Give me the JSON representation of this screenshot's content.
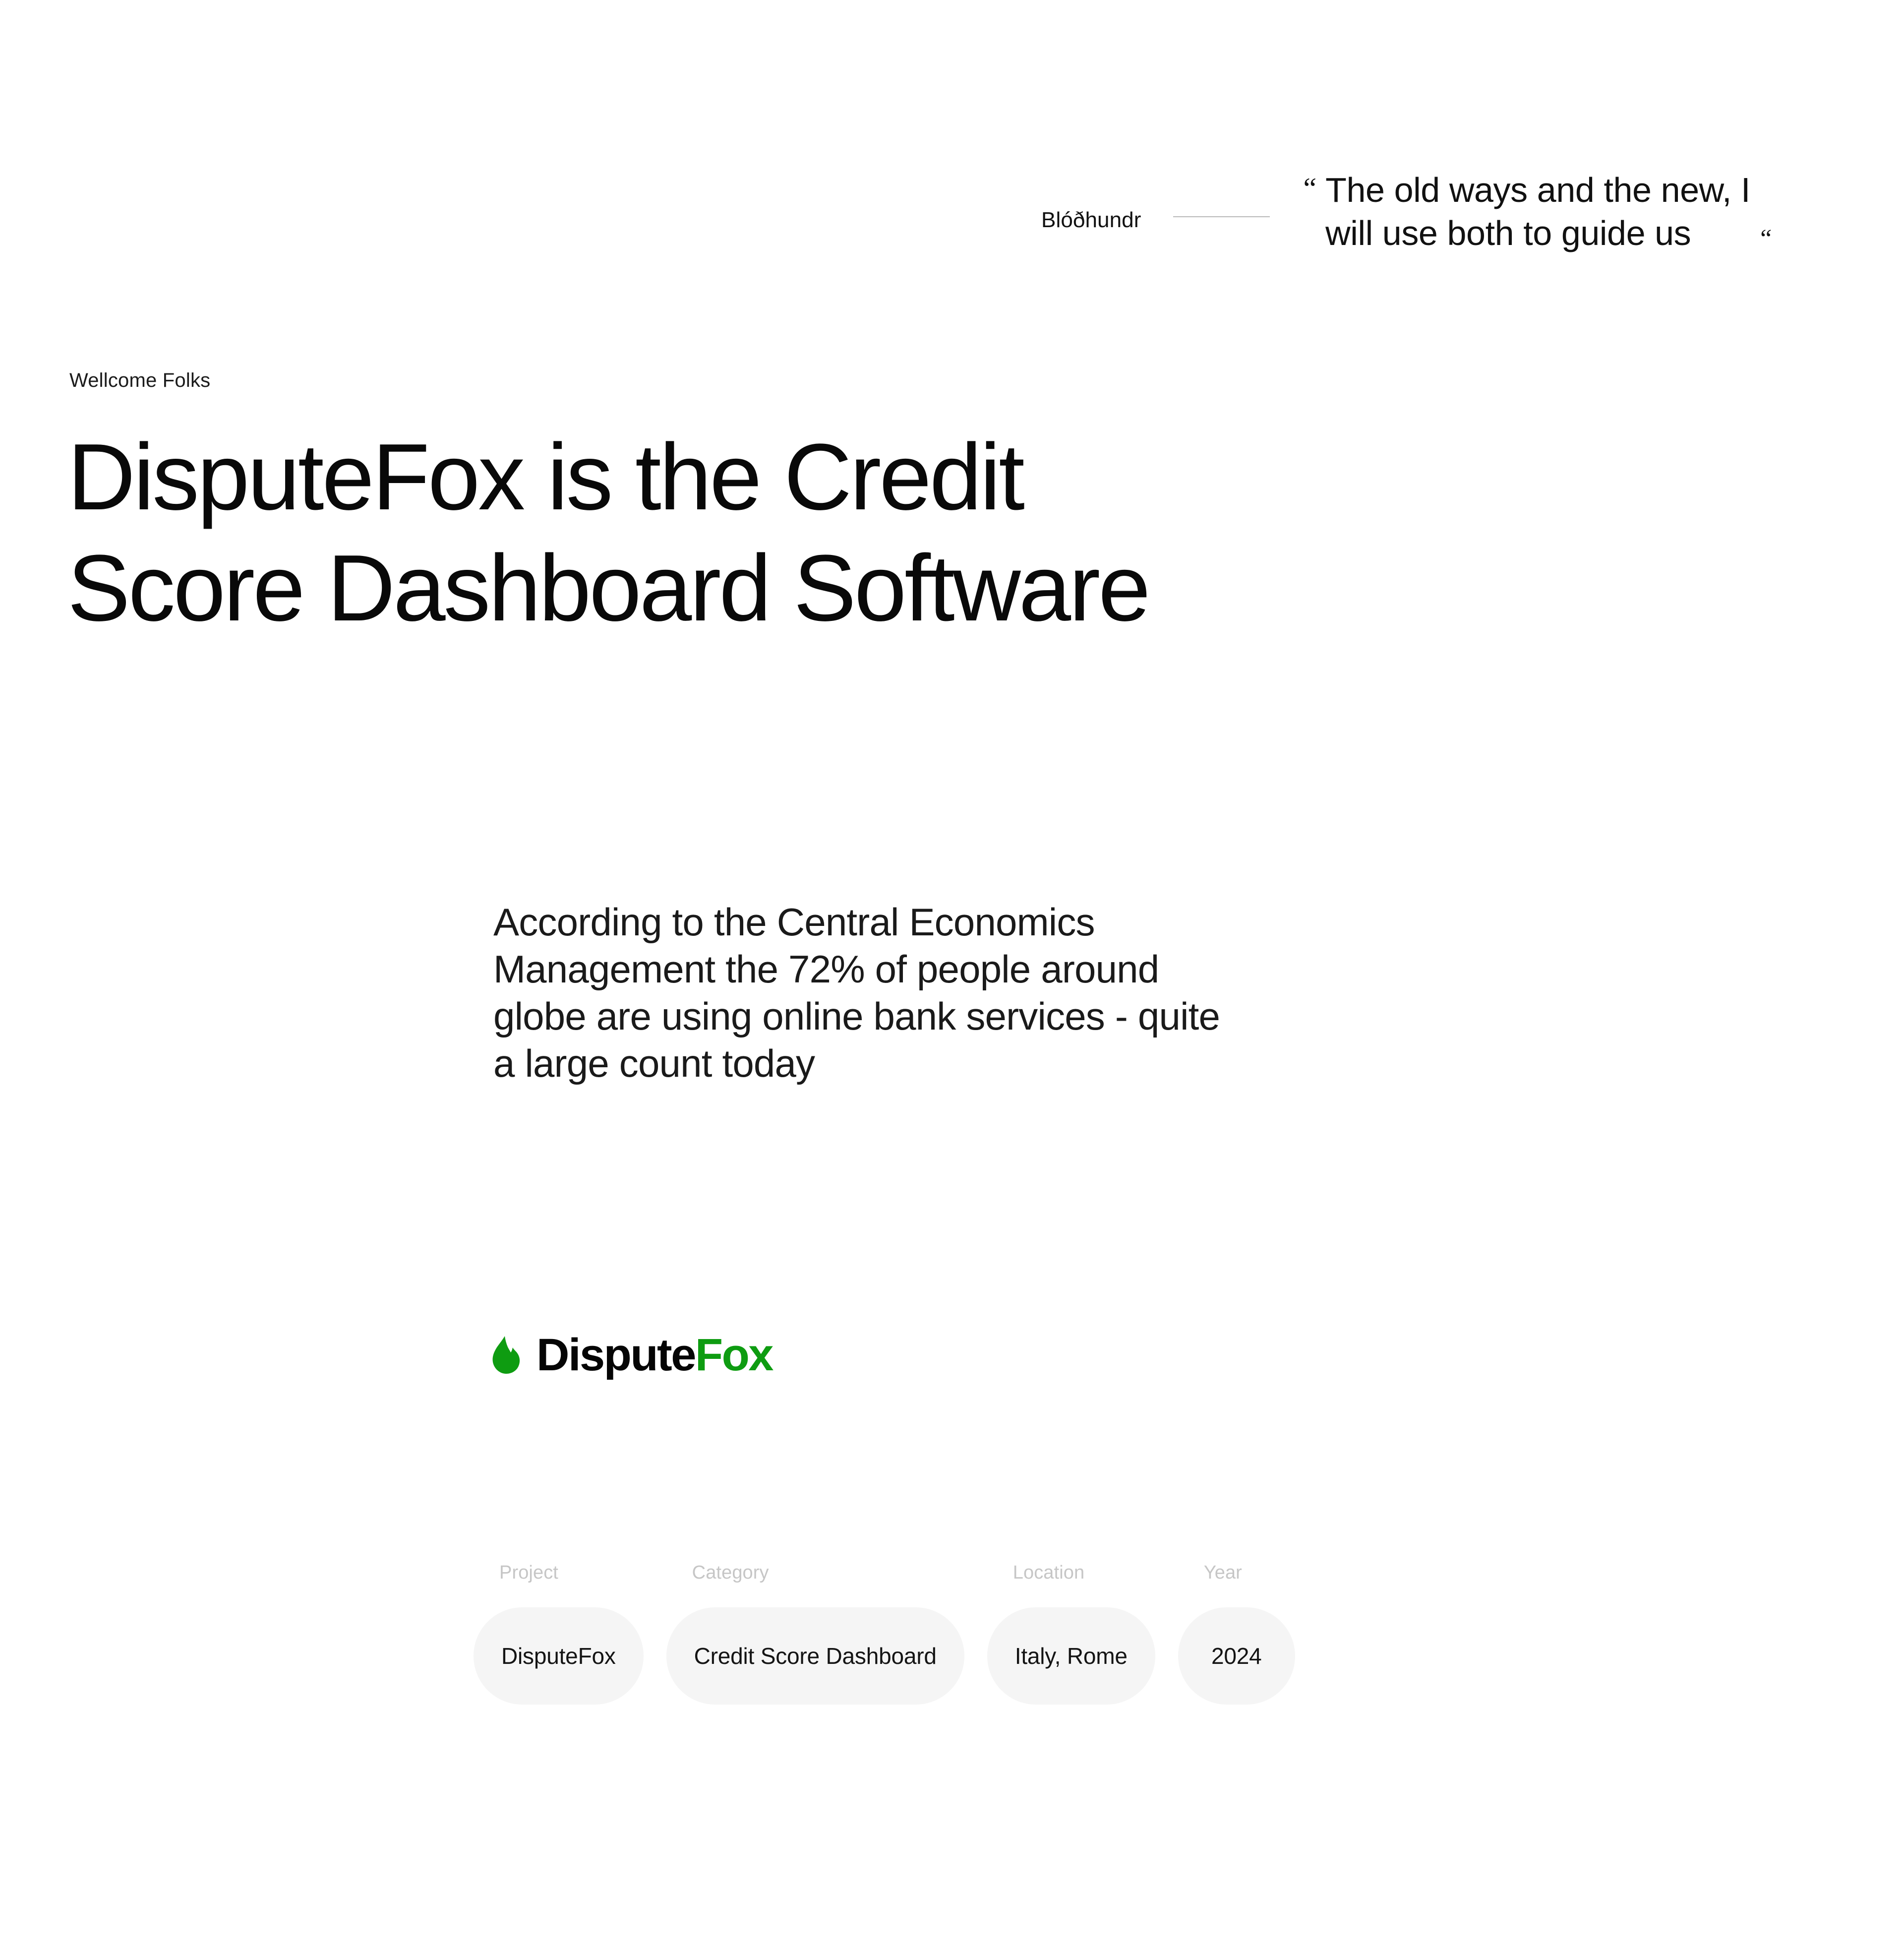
{
  "attribution": {
    "name": "Blóðhundr",
    "quote_open": "“",
    "quote_close": "“",
    "quote_text": "The old ways and the new, I\nwill use both to guide us"
  },
  "hero": {
    "eyebrow": "Wellcome Folks",
    "title": "DisputeFox is the Credit\nScore Dashboard Software",
    "description": "According to the Central Economics\nManagement the 72% of people around\nglobe are using online bank services - quite\na large count today"
  },
  "brand": {
    "name_dark": "Dispute",
    "name_accent": "Fox",
    "icon": "flame-icon",
    "accent_color": "#0e9c11"
  },
  "meta": {
    "columns": [
      {
        "label": "Project",
        "value": "DisputeFox"
      },
      {
        "label": "Category",
        "value": "Credit Score Dashboard"
      },
      {
        "label": "Location",
        "value": "Italy, Rome"
      },
      {
        "label": "Year",
        "value": "2024"
      }
    ]
  },
  "theme": {
    "background": "#ffffff",
    "text": "#111111",
    "muted": "#c6c6c6",
    "pill_background": "#f5f5f5",
    "rule": "#b9b9b9"
  }
}
